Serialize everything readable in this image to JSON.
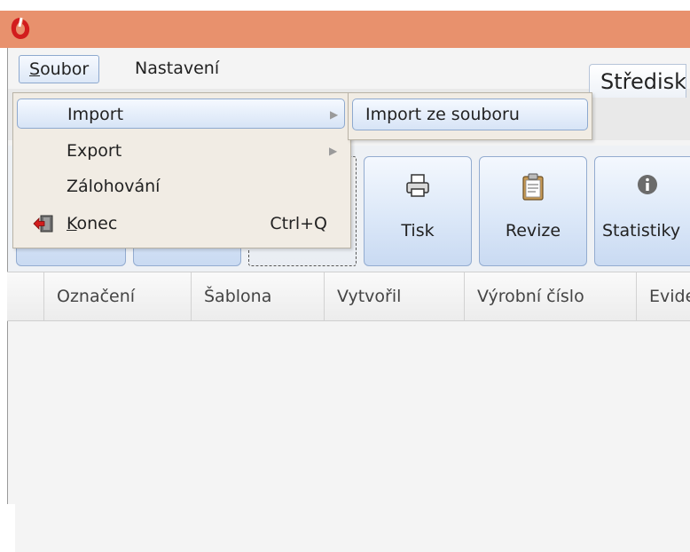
{
  "colors": {
    "titlebar": "#e8916d",
    "menu_bg": "#f1ece4",
    "highlight_border": "#8ea9cf"
  },
  "menubar": {
    "items": [
      {
        "label": "Soubor",
        "mnemonic": "S",
        "rest": "oubor"
      },
      {
        "label": "Nastavení"
      }
    ]
  },
  "tab": {
    "label": "Středisk"
  },
  "file_menu": {
    "items": [
      {
        "label": "Import",
        "submenu": true
      },
      {
        "label": "Export",
        "submenu": true
      },
      {
        "label": "Zálohování"
      },
      {
        "label": "Konec",
        "mnemonic": "K",
        "rest": "onec",
        "shortcut": "Ctrl+Q",
        "icon": "exit-icon"
      }
    ]
  },
  "import_submenu": {
    "items": [
      {
        "label": "Import ze souboru"
      }
    ]
  },
  "toolbar": {
    "buttons": [
      {
        "label": "Tisk",
        "icon": "printer-icon"
      },
      {
        "label": "Revize",
        "icon": "clipboard-icon"
      },
      {
        "label": "Statistiky",
        "icon": "info-icon"
      }
    ]
  },
  "grid": {
    "columns": [
      "Označení",
      "Šablona",
      "Vytvořil",
      "Výrobní číslo",
      "Evidenční číslo"
    ]
  }
}
